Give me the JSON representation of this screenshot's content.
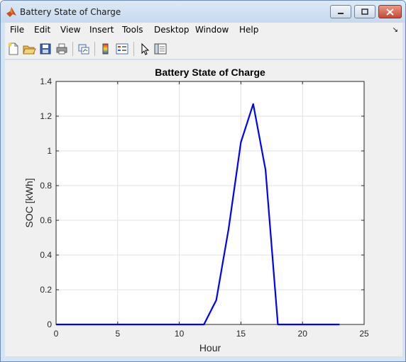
{
  "window": {
    "title": "Battery State of Charge"
  },
  "menubar": {
    "items": [
      "File",
      "Edit",
      "View",
      "Insert",
      "Tools",
      "Desktop",
      "Window",
      "Help"
    ]
  },
  "toolbar": {
    "icons": [
      "new-figure-icon",
      "open-file-icon",
      "save-icon",
      "print-icon",
      "link-plot-icon",
      "insert-colorbar-icon",
      "insert-legend-icon",
      "select-pointer-icon",
      "property-editor-icon"
    ]
  },
  "colors": {
    "line": "#0000ff",
    "axes_background": "#ffffff",
    "figure_background": "#f0f0f0",
    "grid": "#e1e1e1"
  },
  "chart_data": {
    "type": "line",
    "title": "Battery State of Charge",
    "xlabel": "Hour",
    "ylabel": "SOC [kWh]",
    "xlim": [
      0,
      25
    ],
    "ylim": [
      0,
      1.4
    ],
    "xticks": [
      "0",
      "5",
      "10",
      "15",
      "20",
      "25"
    ],
    "yticks": [
      "0",
      "0.2",
      "0.4",
      "0.6",
      "0.8",
      "1",
      "1.2",
      "1.4"
    ],
    "grid": true,
    "x": [
      0,
      1,
      2,
      3,
      4,
      5,
      6,
      7,
      8,
      9,
      10,
      11,
      12,
      13,
      14,
      15,
      16,
      17,
      18,
      19,
      20,
      21,
      22,
      23
    ],
    "y": [
      0,
      0,
      0,
      0,
      0,
      0,
      0,
      0,
      0,
      0,
      0,
      0,
      0,
      0.14,
      0.55,
      1.05,
      1.27,
      0.89,
      0,
      0,
      0,
      0,
      0,
      0
    ]
  }
}
